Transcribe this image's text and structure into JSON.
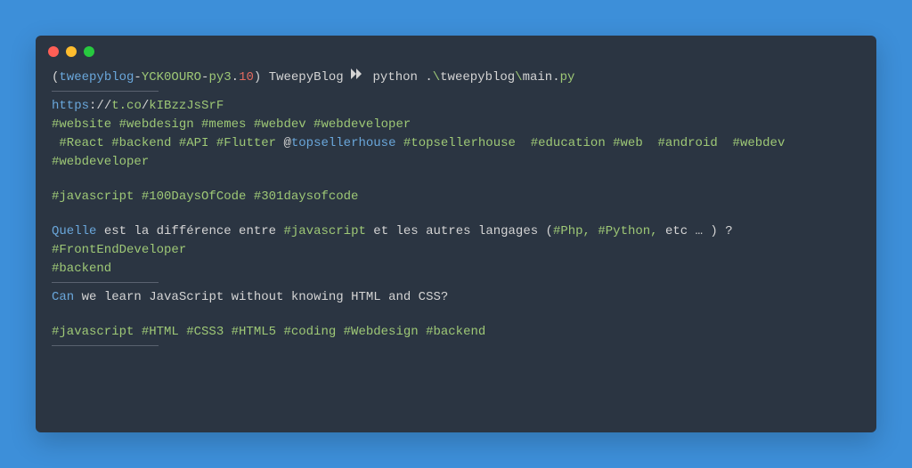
{
  "prompt": {
    "open_paren": "(",
    "env_name": "tweepyblog",
    "dash1": "-",
    "env_hash": "YCK0OURO",
    "dash2": "-",
    "py_prefix": "py3",
    "dot1": ".",
    "py_minor": "10",
    "close_paren": ")",
    "dir": " TweepyBlog ",
    "cmd_prefix": " python .",
    "backslash1": "\\",
    "cmd_pkg": "tweepyblog",
    "backslash2": "\\",
    "cmd_file": "main",
    "dot2": ".",
    "cmd_ext": "py"
  },
  "url": {
    "proto": "https",
    "sep": "://",
    "host": "t.co",
    "slash": "/",
    "path": "kIBzzJsSrF"
  },
  "line_website": "#website #webdesign #memes #webdev #webdeveloper",
  "line_react": {
    "pre": " #React #backend #API #Flutter ",
    "at": "@",
    "mention": "topsellerhouse",
    "post": " #topsellerhouse  #education #web  #android  #webdev #webdeveloper"
  },
  "line_js1": "#javascript #100DaysOfCode #301daysofcode",
  "quelle": {
    "word": "Quelle",
    "mid1": " est la différence entre ",
    "hash_js": "#javascript",
    "mid2": " et les autres langages (",
    "hash_php": "#Php,",
    "space1": " ",
    "hash_python": "#Python,",
    "mid3": " etc … ) ?"
  },
  "line_frontend": "#FrontEndDeveloper",
  "line_backend": "#backend",
  "can": {
    "word": "Can",
    "rest": " we learn JavaScript without knowing HTML and CSS?"
  },
  "line_js2": "#javascript #HTML #CSS3 #HTML5 #coding #Webdesign #backend"
}
